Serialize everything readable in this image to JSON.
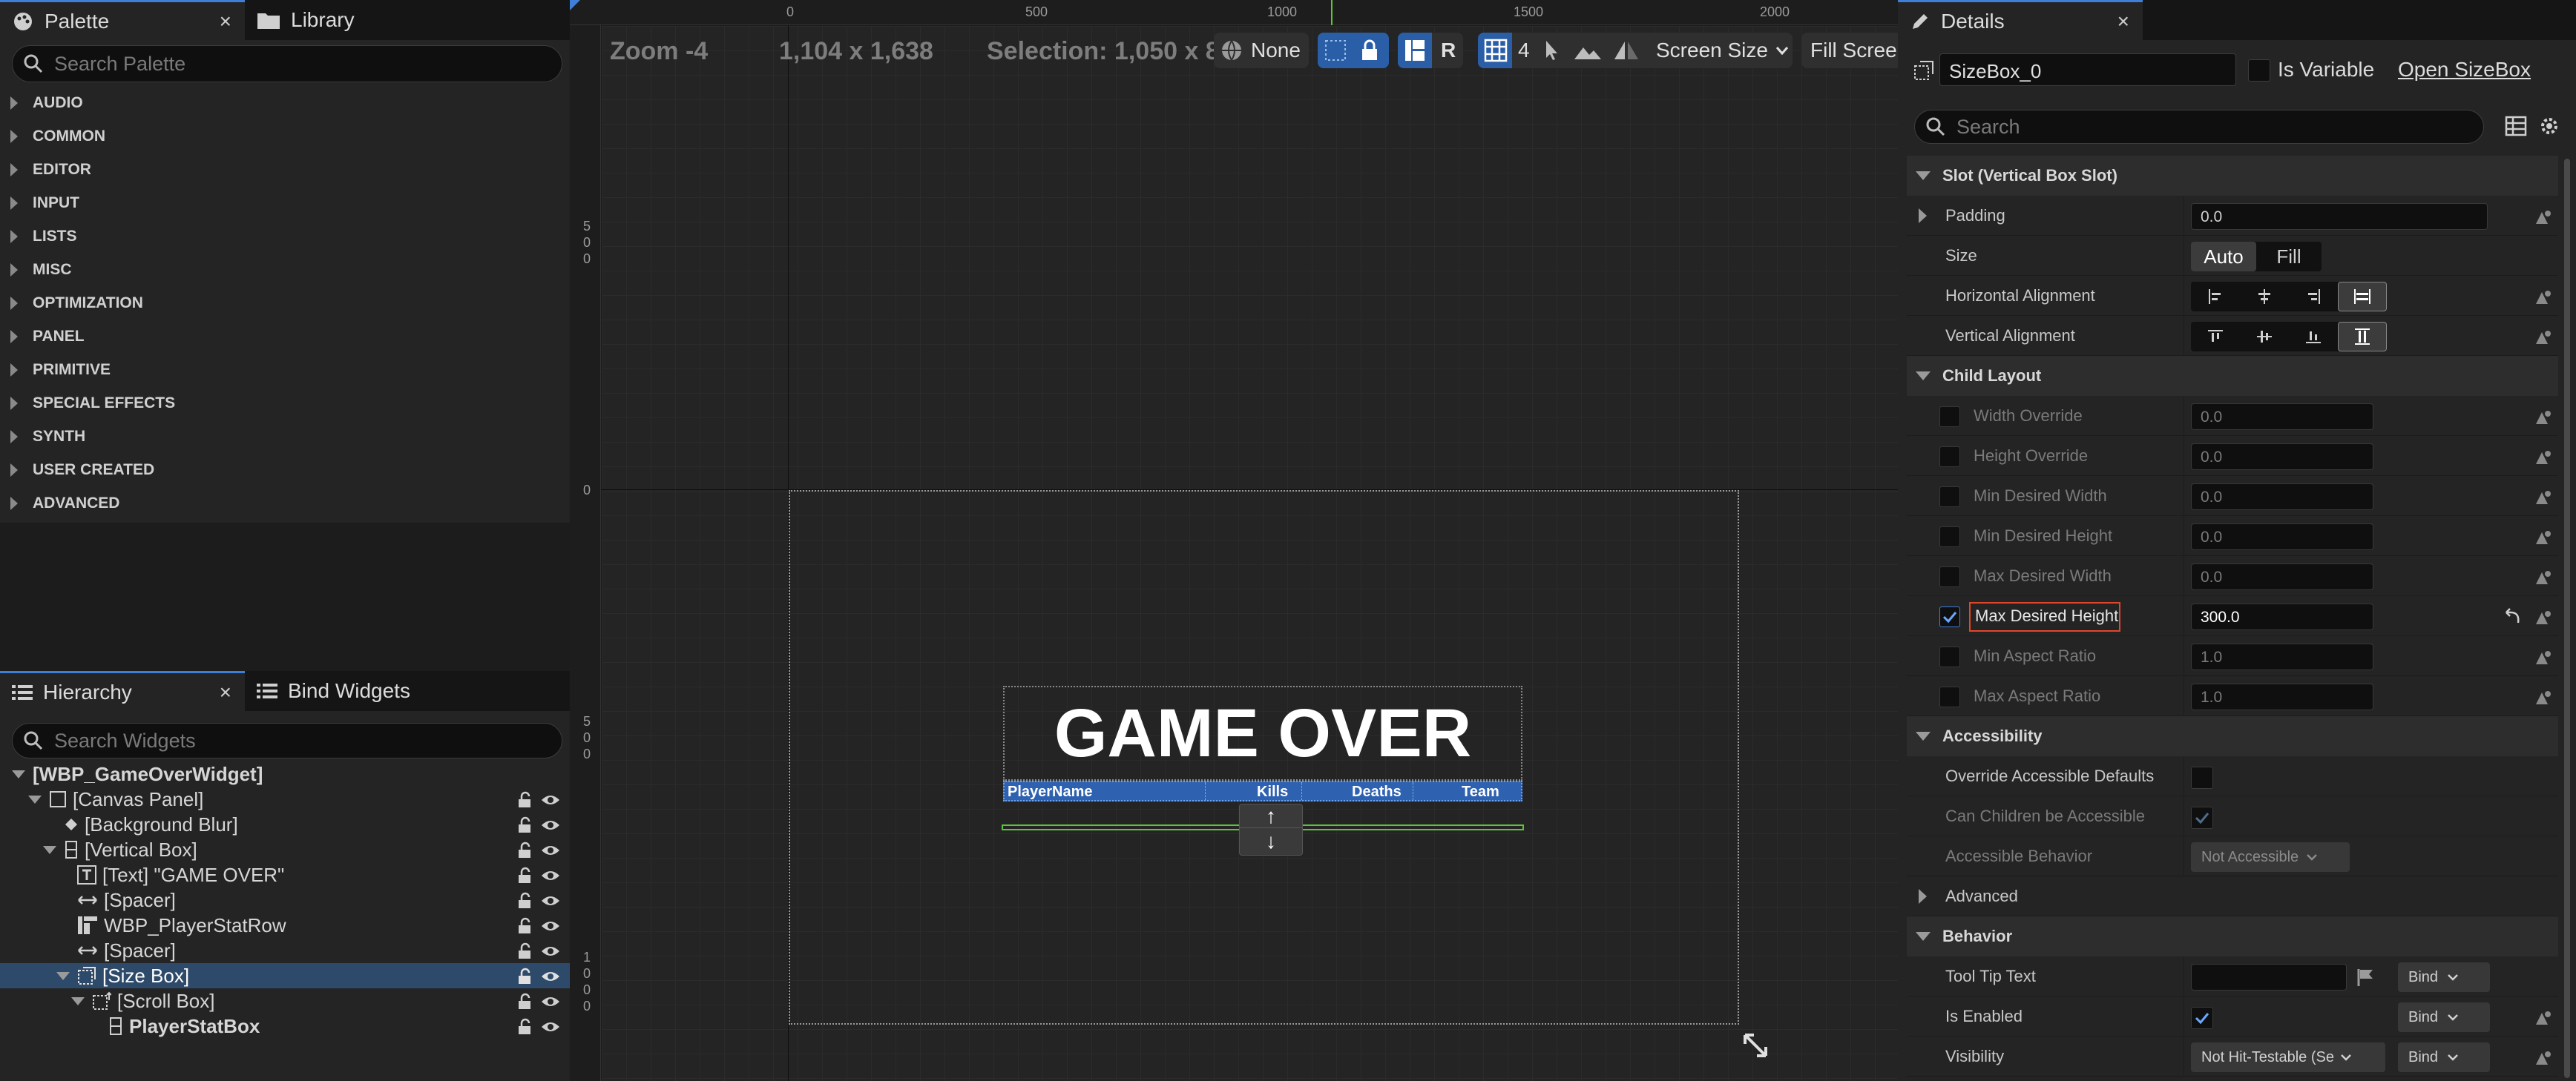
{
  "palette": {
    "tab_label": "Palette",
    "library_tab_label": "Library",
    "search_placeholder": "Search Palette",
    "categories": [
      "AUDIO",
      "COMMON",
      "EDITOR",
      "INPUT",
      "LISTS",
      "MISC",
      "OPTIMIZATION",
      "PANEL",
      "PRIMITIVE",
      "SPECIAL EFFECTS",
      "SYNTH",
      "USER CREATED",
      "ADVANCED"
    ]
  },
  "hierarchy": {
    "tab_label": "Hierarchy",
    "bind_tab_label": "Bind Widgets",
    "search_placeholder": "Search Widgets",
    "items": [
      {
        "label": "[WBP_GameOverWidget]"
      },
      {
        "label": "[Canvas Panel]"
      },
      {
        "label": "[Background Blur]"
      },
      {
        "label": "[Vertical Box]"
      },
      {
        "label": "[Text] \"GAME OVER\""
      },
      {
        "label": "[Spacer]"
      },
      {
        "label": "WBP_PlayerStatRow"
      },
      {
        "label": "[Spacer]"
      },
      {
        "label": "[Size Box]"
      },
      {
        "label": "[Scroll Box]"
      },
      {
        "label": "PlayerStatBox"
      }
    ]
  },
  "viewport": {
    "zoom": "Zoom -4",
    "resolution": "1,104 x 1,638",
    "selection": "Selection: 1,050 x 8",
    "none_label": "None",
    "r_label": "R",
    "grid_count": "4",
    "screen_size": "Screen Size",
    "fill_screen": "Fill Screen",
    "ruler_top": [
      "0",
      "500",
      "1000",
      "1500",
      "2000"
    ],
    "ruler_left": [
      [
        "5",
        "0",
        "0"
      ],
      [
        "0"
      ],
      [
        "5",
        "0",
        "0"
      ],
      [
        "1",
        "0",
        "0",
        "0"
      ]
    ],
    "game_over_text": "GAME OVER",
    "stat_columns": [
      "PlayerName",
      "Kills",
      "Deaths",
      "Team"
    ],
    "scroll_up": "↑",
    "scroll_down": "↓"
  },
  "details": {
    "tab_label": "Details",
    "name_value": "SizeBox_0",
    "is_variable_label": "Is Variable",
    "open_link": "Open SizeBox",
    "search_placeholder": "Search",
    "sections": {
      "slot": "Slot (Vertical Box Slot)",
      "child_layout": "Child Layout",
      "accessibility": "Accessibility",
      "behavior": "Behavior"
    },
    "slot": {
      "padding_label": "Padding",
      "padding_value": "0.0",
      "size_label": "Size",
      "size_auto": "Auto",
      "size_fill": "Fill",
      "h_align_label": "Horizontal Alignment",
      "v_align_label": "Vertical Alignment"
    },
    "child_layout": [
      {
        "label": "Width Override",
        "value": "0.0",
        "checked": false
      },
      {
        "label": "Height Override",
        "value": "0.0",
        "checked": false
      },
      {
        "label": "Min Desired Width",
        "value": "0.0",
        "checked": false
      },
      {
        "label": "Min Desired Height",
        "value": "0.0",
        "checked": false
      },
      {
        "label": "Max Desired Width",
        "value": "0.0",
        "checked": false
      },
      {
        "label": "Max Desired Height",
        "value": "300.0",
        "checked": true
      },
      {
        "label": "Min Aspect Ratio",
        "value": "1.0",
        "checked": false
      },
      {
        "label": "Max Aspect Ratio",
        "value": "1.0",
        "checked": false
      }
    ],
    "accessibility": {
      "override_label": "Override Accessible Defaults",
      "children_label": "Can Children be Accessible",
      "behavior_label": "Accessible Behavior",
      "behavior_value": "Not Accessible",
      "advanced_label": "Advanced"
    },
    "behavior": {
      "tooltip_label": "Tool Tip Text",
      "enabled_label": "Is Enabled",
      "visibility_label": "Visibility",
      "visibility_value": "Not Hit-Testable (Se",
      "bind_label": "Bind"
    }
  }
}
